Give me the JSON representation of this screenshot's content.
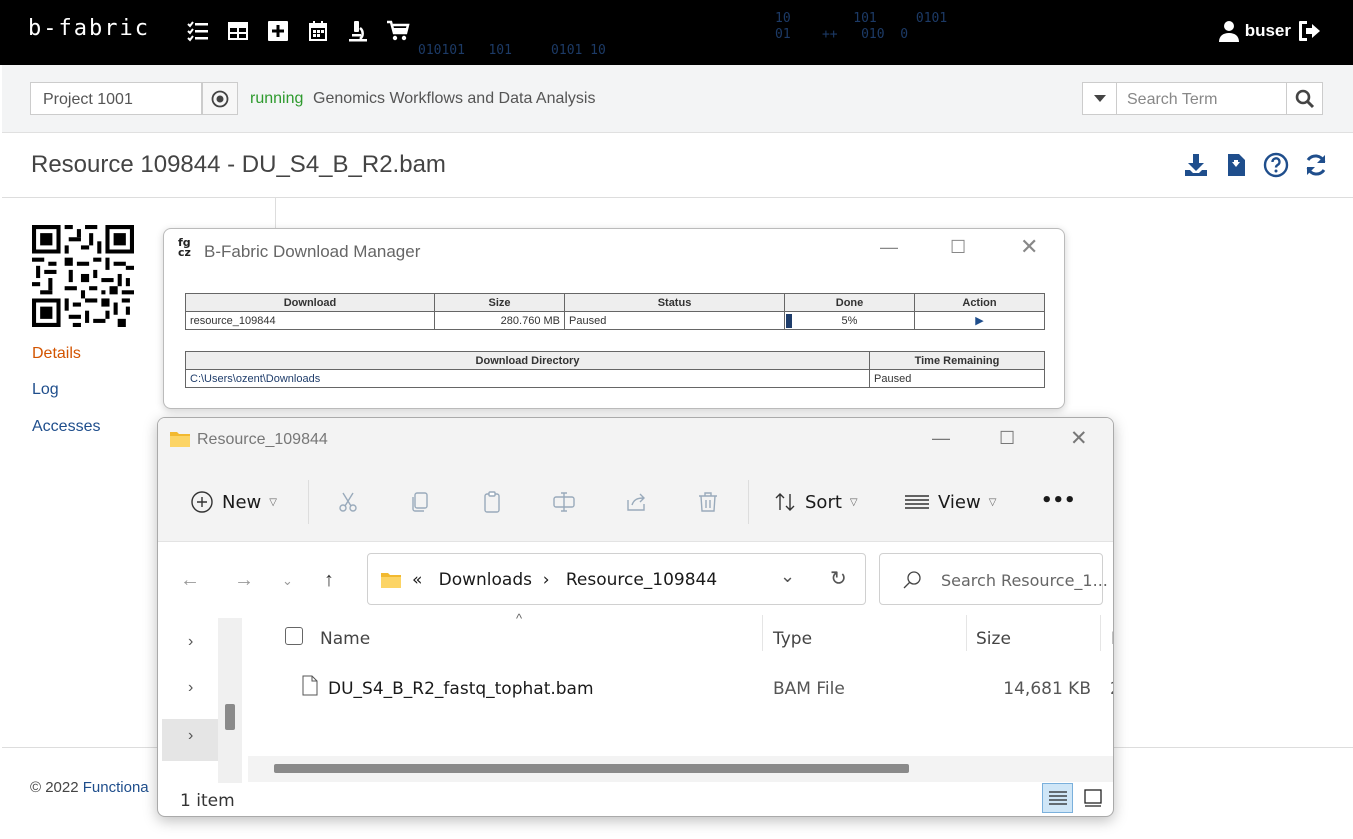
{
  "app": {
    "logo": "b-fabric",
    "user": "buser",
    "matrix_lines": [
      "10        101     0101",
      "01    ++   010  0",
      "010101   101     0101 10"
    ]
  },
  "project": {
    "value": "Project 1001",
    "status": "running",
    "name": "Genomics Workflows and Data Analysis"
  },
  "search": {
    "placeholder": "Search Term"
  },
  "resource": {
    "title": "Resource 109844 - DU_S4_B_R2.bam"
  },
  "sidebar": {
    "items": [
      {
        "label": "Details",
        "color": "#d35400"
      },
      {
        "label": "Log",
        "color": "#1f4e8c"
      },
      {
        "label": "Accesses",
        "color": "#1f4e8c"
      }
    ]
  },
  "footer": {
    "copyright": "© 2022",
    "link": "Functiona"
  },
  "download_manager": {
    "logo_top": "fg",
    "logo_bottom": "cz",
    "title": "B-Fabric Download Manager",
    "columns": [
      "Download",
      "Size",
      "Status",
      "Done",
      "Action"
    ],
    "rows": [
      {
        "download": "resource_109844",
        "size": "280.760 MB",
        "status": "Paused",
        "done": "5%",
        "progress": 0.05
      }
    ],
    "dir_columns": [
      "Download Directory",
      "Time Remaining"
    ],
    "dir_rows": [
      {
        "directory": "C:\\Users\\ozent\\Downloads",
        "remaining": "Paused"
      }
    ]
  },
  "explorer": {
    "title": "Resource_109844",
    "toolbar": {
      "new": "New",
      "sort": "Sort",
      "view": "View",
      "more": "•••"
    },
    "address": {
      "prefix": "«",
      "crumbs": [
        "Downloads",
        "Resource_109844"
      ]
    },
    "search_placeholder": "Search Resource_1...",
    "columns": [
      "Name",
      "Type",
      "Size",
      "D"
    ],
    "files": [
      {
        "name": "DU_S4_B_R2_fastq_tophat.bam",
        "type": "BAM File",
        "size": "14,681 KB",
        "date_fragment": "2"
      }
    ],
    "status": "1 item"
  }
}
